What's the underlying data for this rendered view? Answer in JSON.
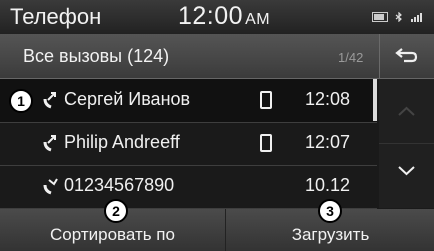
{
  "status_bar": {
    "title": "Телефон",
    "time": "12:00",
    "ampm": "AM"
  },
  "header": {
    "title": "Все вызовы (124)",
    "page": "1/42"
  },
  "calls": [
    {
      "name": "Сергей Иванов",
      "time": "12:08",
      "call_type": "outgoing-call-icon",
      "phone_type": "mobile-phone-icon"
    },
    {
      "name": "Philip Andreeff",
      "time": "12:07",
      "call_type": "outgoing-call-icon",
      "phone_type": "mobile-phone-icon"
    },
    {
      "name": "01234567890",
      "time": "10.12",
      "call_type": "missed-call-icon",
      "phone_type": ""
    }
  ],
  "bottom_bar": {
    "sort_label": "Сортировать по",
    "load_label": "Загрузить"
  },
  "callouts": [
    "1",
    "2",
    "3"
  ]
}
